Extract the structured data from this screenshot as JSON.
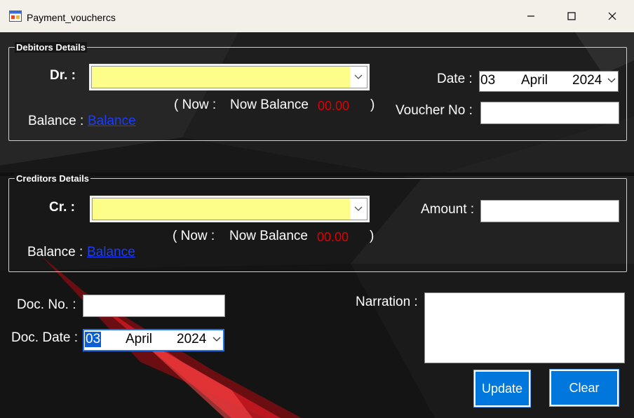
{
  "window": {
    "title": "Payment_vouchercs",
    "icon": "app-form-icon",
    "controls": [
      "minimize-icon",
      "maximize-icon",
      "close-icon"
    ]
  },
  "debitors": {
    "group_title": "Debitors Details",
    "dr_label": "Dr. :",
    "dr_value": "",
    "now_open": "(  Now :",
    "now_balance_label": "Now Balance",
    "now_balance_value": "00.00",
    "now_close": ")",
    "balance_label": "Balance :",
    "balance_link": "Balance",
    "date_label": "Date :",
    "date": {
      "day": "03",
      "month": "April",
      "year": "2024"
    },
    "voucher_label": "Voucher No :",
    "voucher_value": ""
  },
  "creditors": {
    "group_title": "Creditors Details",
    "cr_label": "Cr. :",
    "cr_value": "",
    "now_open": "(  Now :",
    "now_balance_label": "Now Balance",
    "now_balance_value": "00.00",
    "now_close": ")",
    "balance_label": "Balance :",
    "balance_link": "Balance",
    "amount_label": "Amount :",
    "amount_value": ""
  },
  "document": {
    "doc_no_label": "Doc. No. :",
    "doc_no_value": "",
    "doc_date_label": "Doc. Date :",
    "doc_date": {
      "day": "03",
      "month": "April",
      "year": "2024"
    },
    "narration_label": "Narration :",
    "narration_value": ""
  },
  "buttons": {
    "update": "Update",
    "clear": "Clear"
  },
  "colors": {
    "combo_bg": "#fdfd8a",
    "button_bg": "#0077dd",
    "balance_red": "#e00000",
    "link_blue": "#1a3cff"
  }
}
